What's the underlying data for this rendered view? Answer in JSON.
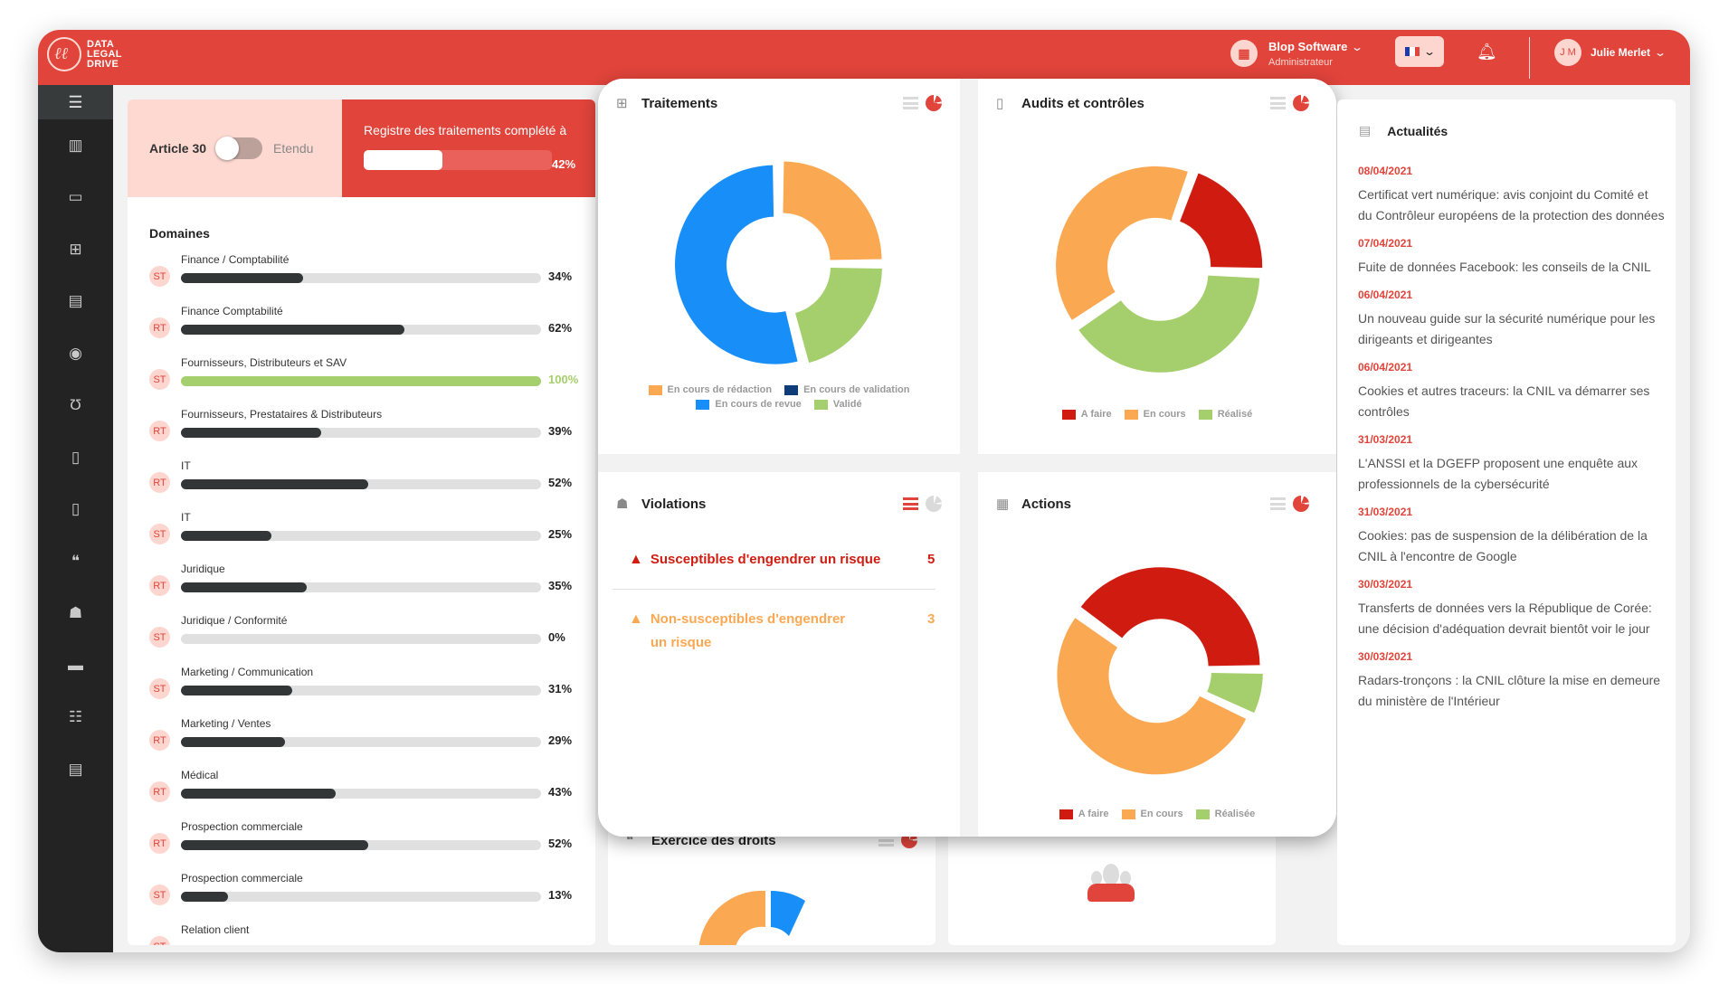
{
  "header": {
    "logo_lines": [
      "DATA",
      "LEGAL",
      "DRIVE"
    ],
    "company_name": "Blop Software",
    "company_role": "Administrateur",
    "language": "FR",
    "user_initials": "J M",
    "user_name": "Julie Merlet"
  },
  "sidebar": {
    "items": [
      {
        "icon": "building-icon"
      },
      {
        "icon": "calendar-icon"
      },
      {
        "icon": "table-icon"
      },
      {
        "icon": "file-icon"
      },
      {
        "icon": "disc-icon"
      },
      {
        "icon": "stethoscope-icon"
      },
      {
        "icon": "file-archive-icon"
      },
      {
        "icon": "file-medical-icon"
      },
      {
        "icon": "quote-icon"
      },
      {
        "icon": "user-secret-icon"
      },
      {
        "icon": "book-icon"
      },
      {
        "icon": "clipboard-list-icon"
      },
      {
        "icon": "newspaper-icon"
      }
    ]
  },
  "article30": {
    "label": "Article 30",
    "toggle_right_label": "Etendu",
    "registre_title": "Registre des traitements complété à",
    "registre_progress": 42,
    "registre_pct_label": "42%"
  },
  "domains": {
    "title": "Domaines",
    "items": [
      {
        "badge": "ST",
        "name": "Finance / Comptabilité",
        "value": 34,
        "label": "34%"
      },
      {
        "badge": "RT",
        "name": "Finance Comptabilité",
        "value": 62,
        "label": "62%"
      },
      {
        "badge": "ST",
        "name": "Fournisseurs, Distributeurs et SAV",
        "value": 100,
        "label": "100%"
      },
      {
        "badge": "RT",
        "name": "Fournisseurs, Prestataires & Distributeurs",
        "value": 39,
        "label": "39%"
      },
      {
        "badge": "RT",
        "name": "IT",
        "value": 52,
        "label": "52%"
      },
      {
        "badge": "ST",
        "name": "IT",
        "value": 25,
        "label": "25%"
      },
      {
        "badge": "RT",
        "name": "Juridique",
        "value": 35,
        "label": "35%"
      },
      {
        "badge": "ST",
        "name": "Juridique / Conformité",
        "value": 0,
        "label": "0%"
      },
      {
        "badge": "ST",
        "name": "Marketing / Communication",
        "value": 31,
        "label": "31%"
      },
      {
        "badge": "RT",
        "name": "Marketing / Ventes",
        "value": 29,
        "label": "29%"
      },
      {
        "badge": "RT",
        "name": "Médical",
        "value": 43,
        "label": "43%"
      },
      {
        "badge": "RT",
        "name": "Prospection commerciale",
        "value": 52,
        "label": "52%"
      },
      {
        "badge": "ST",
        "name": "Prospection commerciale",
        "value": 13,
        "label": "13%"
      },
      {
        "badge": "ST",
        "name": "Relation client",
        "value": null,
        "label": ""
      }
    ]
  },
  "colors": {
    "brand_red": "#e1443b",
    "orange": "#fba853",
    "blue": "#188ff8",
    "navy": "#0d3c78",
    "green": "#a5cf6c",
    "dark_red": "#d01c10",
    "complete_green": "#a5cf6c"
  },
  "cards": {
    "traitements": {
      "title": "Traitements",
      "legend": [
        "En cours de rédaction",
        "En cours de validation",
        "En cours de revue",
        "Validé"
      ]
    },
    "audits": {
      "title": "Audits et contrôles",
      "legend": [
        "A faire",
        "En cours",
        "Réalisé"
      ]
    },
    "violations": {
      "title": "Violations",
      "items": [
        {
          "label": "Susceptibles d'engendrer un risque",
          "count": "5"
        },
        {
          "label": "Non-susceptibles d'engendrer un risque",
          "count": "3"
        }
      ]
    },
    "actions": {
      "title": "Actions",
      "legend": [
        "A faire",
        "En cours",
        "Réalisée"
      ]
    },
    "exercice": {
      "title": "Exercice des droits"
    }
  },
  "chart_data": [
    {
      "type": "pie",
      "title": "Traitements",
      "categories": [
        "En cours de rédaction",
        "En cours de validation",
        "En cours de revue",
        "Validé"
      ],
      "values": [
        25,
        0,
        54,
        21
      ],
      "order_drawn": [
        "En cours de rédaction",
        "Validé",
        "En cours de revue"
      ],
      "donut": true,
      "legend": "bottom"
    },
    {
      "type": "pie",
      "title": "Audits et contrôles",
      "categories": [
        "A faire",
        "En cours",
        "Réalisé"
      ],
      "values": [
        20,
        40,
        40
      ],
      "donut": true,
      "legend": "bottom"
    },
    {
      "type": "pie",
      "title": "Actions",
      "categories": [
        "A faire",
        "En cours",
        "Réalisée"
      ],
      "values": [
        40,
        53,
        7
      ],
      "donut": true,
      "legend": "bottom"
    }
  ],
  "news": {
    "title": "Actualités",
    "items": [
      {
        "date": "08/04/2021",
        "text": "Certificat vert numérique: avis conjoint du Comité et du Contrôleur européens de la protection des données"
      },
      {
        "date": "07/04/2021",
        "text": "Fuite de données Facebook: les conseils de la CNIL"
      },
      {
        "date": "06/04/2021",
        "text": "Un nouveau guide sur la sécurité numérique pour les dirigeants et dirigeantes"
      },
      {
        "date": "06/04/2021",
        "text": "Cookies et autres traceurs: la CNIL va démarrer ses contrôles"
      },
      {
        "date": "31/03/2021",
        "text": "L'ANSSI et la DGEFP proposent une enquête aux professionnels de la cybersécurité"
      },
      {
        "date": "31/03/2021",
        "text": "Cookies: pas de suspension de la délibération de la CNIL à l'encontre de Google"
      },
      {
        "date": "30/03/2021",
        "text": "Transferts de données vers la République de Corée: une décision d'adéquation devrait bientôt voir le jour"
      },
      {
        "date": "30/03/2021",
        "text": "Radars-tronçons : la CNIL clôture la mise en demeure du ministère de l'Intérieur"
      }
    ]
  }
}
